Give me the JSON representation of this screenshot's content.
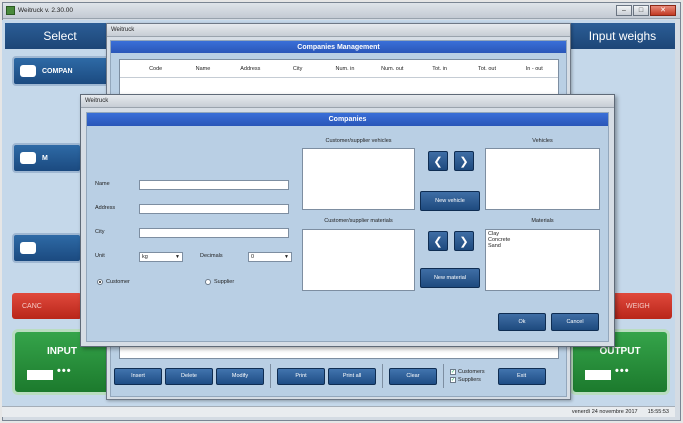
{
  "app": {
    "title": "Weitruck v. 2.30.00",
    "controls": [
      "–",
      "□",
      "✕"
    ]
  },
  "left_panel": {
    "header": "Select",
    "buttons": [
      "COMPAN",
      "M",
      ""
    ],
    "red_label": "CANC",
    "input_label": "INPUT"
  },
  "right_panel": {
    "header": "Input weighs",
    "red_label": "WEIGH",
    "output_label": "OUTPUT"
  },
  "status": {
    "date": "venerdì 24 novembre 2017",
    "time": "15:55:53"
  },
  "companies_management": {
    "window_title": "Weitruck",
    "header": "Companies Management",
    "columns": [
      "",
      "Code",
      "Name",
      "Address",
      "City",
      "Num. in",
      "Num. out",
      "Tot. in",
      "Tot. out",
      "In - out"
    ],
    "toolbar": {
      "insert": "Insert",
      "delete": "Delete",
      "modify": "Modify",
      "print": "Print",
      "print_all": "Print all",
      "clear": "Clear",
      "exit": "Exit",
      "customers": "Customers",
      "suppliers": "Suppliers"
    }
  },
  "companies": {
    "window_title": "Weitruck",
    "header": "Companies",
    "fields": {
      "name_label": "Name",
      "address_label": "Address",
      "city_label": "City",
      "unit_label": "Unit",
      "unit_value": "kg",
      "decimals_label": "Decimals",
      "decimals_value": "0"
    },
    "radio": {
      "customer": "Customer",
      "supplier": "Supplier"
    },
    "sections": {
      "cs_vehicles": "Customer/supplier vehicles",
      "vehicles": "Vehicles",
      "cs_materials": "Customer/supplier materials",
      "materials": "Materials"
    },
    "materials_list": [
      "Clay",
      "Concrete",
      "Sand"
    ],
    "new_vehicle": "New vehicle",
    "new_material": "New material",
    "ok": "Ok",
    "cancel": "Cancel",
    "arrow_left": "❮",
    "arrow_right": "❯"
  }
}
